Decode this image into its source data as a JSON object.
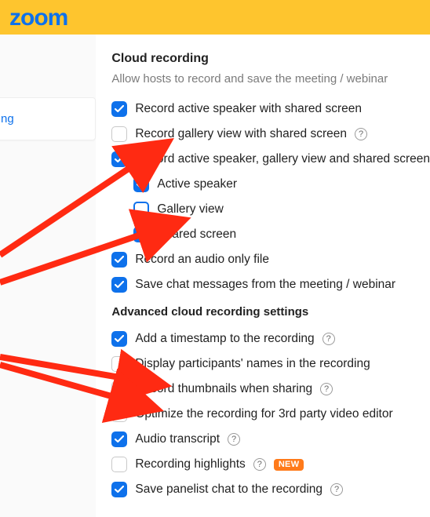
{
  "logo_text": "zoom",
  "sidebar": {
    "items": [
      {
        "label": "ng"
      }
    ]
  },
  "main": {
    "section1": {
      "title": "Cloud recording",
      "desc": "Allow hosts to record and save the meeting / webinar"
    },
    "opts1": [
      {
        "label": "Record active speaker with shared screen",
        "checked": true,
        "help": false
      },
      {
        "label": "Record gallery view with shared screen",
        "checked": false,
        "help": true
      },
      {
        "label": "Record active speaker, gallery view and shared screen",
        "checked": true,
        "help": false
      }
    ],
    "sub_opts": [
      {
        "label": "Active speaker",
        "checked": true
      },
      {
        "label": "Gallery view",
        "checked": false,
        "focus": true
      },
      {
        "label": "Shared screen",
        "checked": true
      }
    ],
    "opts2": [
      {
        "label": "Record an audio only file",
        "checked": true
      },
      {
        "label": "Save chat messages from the meeting / webinar",
        "checked": true
      }
    ],
    "section2": {
      "title": "Advanced cloud recording settings"
    },
    "opts3": [
      {
        "label": "Add a timestamp to the recording",
        "checked": true,
        "help": true
      },
      {
        "label": "Display participants' names in the recording",
        "checked": false,
        "help": false
      },
      {
        "label": "Record thumbnails when sharing",
        "checked": false,
        "help": true
      },
      {
        "label": "Optimize the recording for 3rd party video editor",
        "checked": false,
        "help": false
      },
      {
        "label": "Audio transcript",
        "checked": true,
        "help": true
      },
      {
        "label": "Recording highlights",
        "checked": false,
        "help": true,
        "new": true
      },
      {
        "label": "Save panelist chat to the recording",
        "checked": true,
        "help": true
      }
    ],
    "new_badge": "NEW"
  }
}
